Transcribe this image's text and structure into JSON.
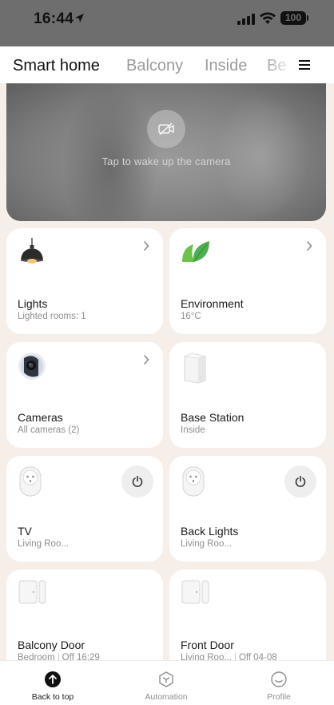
{
  "status_bar": {
    "time": "16:44",
    "battery": "100"
  },
  "tabs": [
    {
      "label": "Smart home",
      "active": true
    },
    {
      "label": "Balcony",
      "active": false
    },
    {
      "label": "Inside",
      "active": false
    },
    {
      "label": "Be",
      "active": false
    }
  ],
  "camera": {
    "wake_text": "Tap to wake up the camera",
    "icon": "camera-off-icon"
  },
  "devices": [
    {
      "name": "Lights",
      "subtitle": "Lighted rooms: 1",
      "icon": "pendant-lamp-icon",
      "control": "chevron"
    },
    {
      "name": "Environment",
      "subtitle": "16°C",
      "icon": "leaf-icon",
      "control": "chevron"
    },
    {
      "name": "Cameras",
      "subtitle": "All cameras (2)",
      "icon": "camera-icon",
      "control": "chevron"
    },
    {
      "name": "Base Station",
      "subtitle": "Inside",
      "icon": "base-station-icon",
      "control": "none"
    },
    {
      "name": "TV",
      "subtitle": "Living Roo...",
      "icon": "smart-plug-icon",
      "control": "power"
    },
    {
      "name": "Back Lights",
      "subtitle": "Living Roo...",
      "icon": "smart-plug-icon",
      "control": "power"
    },
    {
      "name": "Balcony Door",
      "subtitle_room": "Bedroom",
      "subtitle_status": "Off 16:29",
      "icon": "door-sensor-icon",
      "control": "none"
    },
    {
      "name": "Front Door",
      "subtitle_room": "Living Roo...",
      "subtitle_status": "Off 04-08",
      "icon": "door-sensor-icon",
      "control": "none"
    }
  ],
  "bottom_nav": [
    {
      "label": "Back to top",
      "icon": "arrow-up-circle-icon",
      "active": true
    },
    {
      "label": "Automation",
      "icon": "hexagon-icon",
      "active": false
    },
    {
      "label": "Profile",
      "icon": "smiley-face-icon",
      "active": false
    }
  ],
  "colors": {
    "background": "#f6efe9",
    "card": "#ffffff",
    "status_bar": "#6e6e6e",
    "inactive_text": "#9b9b9b",
    "leaf_green": "#4caf50"
  }
}
